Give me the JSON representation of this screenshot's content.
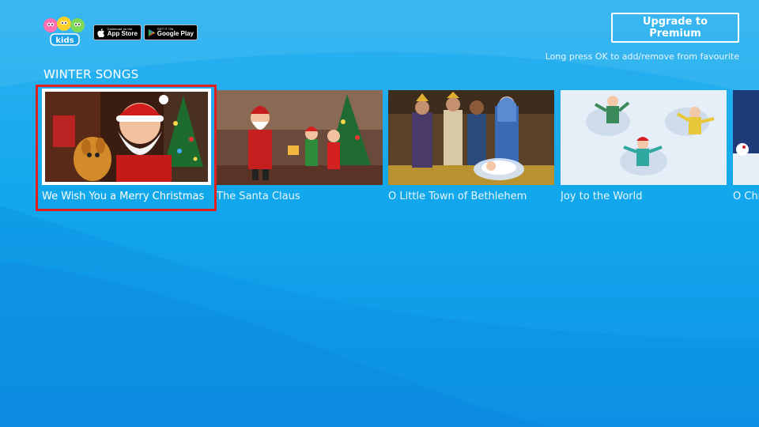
{
  "header": {
    "logo_text": "Hey kids",
    "app_store": {
      "small": "Download on the",
      "big": "App Store"
    },
    "google_play": {
      "small": "GET IT ON",
      "big": "Google Play"
    },
    "premium_button": "Upgrade to Premium",
    "hint": "Long press OK to add/remove from favourite"
  },
  "section": {
    "title": "WINTER SONGS",
    "items": [
      {
        "title": "We Wish You a Merry Christmas",
        "selected": true
      },
      {
        "title": "The Santa Claus",
        "selected": false
      },
      {
        "title": "O Little Town of Bethlehem",
        "selected": false
      },
      {
        "title": "Joy to the World",
        "selected": false
      },
      {
        "title": "O Christmas Tree",
        "selected": false
      }
    ]
  },
  "colors": {
    "focus": "#e02020",
    "background": "#12a8ec"
  }
}
